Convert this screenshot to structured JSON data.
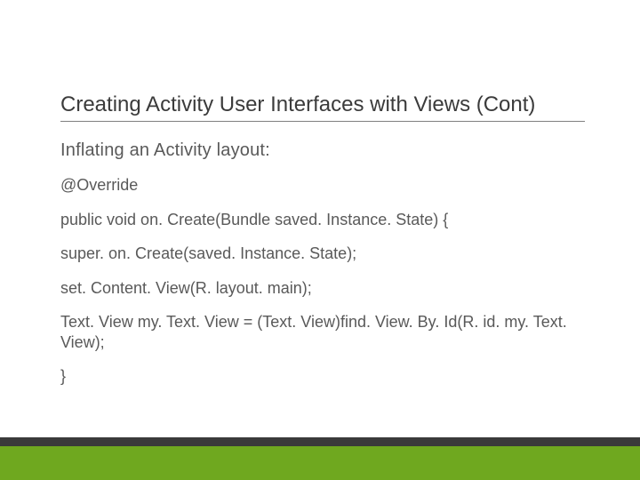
{
  "title": "Creating Activity User Interfaces with Views (Cont)",
  "subhead": "Inflating an Activity layout:",
  "code": {
    "l1": "@Override",
    "l2": "public void on. Create(Bundle saved. Instance. State) {",
    "l3": "super. on. Create(saved. Instance. State);",
    "l4": "set. Content. View(R. layout. main);",
    "l5": "Text. View my. Text. View = (Text. View)find. View. By. Id(R. id. my. Text. View);",
    "l6": "}"
  }
}
